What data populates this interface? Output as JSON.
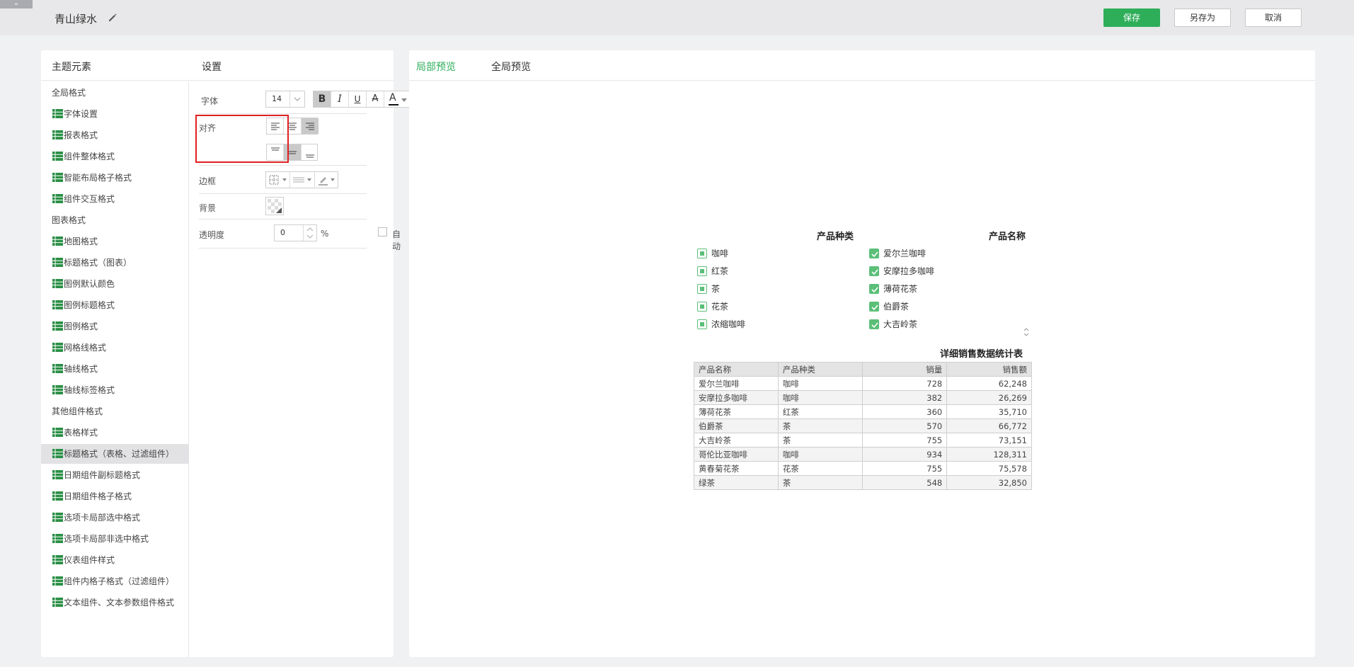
{
  "header": {
    "collapse_glyph": "⌄",
    "title": "青山绿水",
    "save_label": "保存",
    "save_as_label": "另存为",
    "cancel_label": "取消",
    "accent_color": "#2fae5a"
  },
  "left_panel": {
    "elements_heading": "主题元素",
    "settings_heading": "设置",
    "items": [
      {
        "label": "全局格式",
        "type": "group"
      },
      {
        "label": "字体设置",
        "type": "child"
      },
      {
        "label": "报表格式",
        "type": "child"
      },
      {
        "label": "组件整体格式",
        "type": "child"
      },
      {
        "label": "智能布局格子格式",
        "type": "child"
      },
      {
        "label": "组件交互格式",
        "type": "child"
      },
      {
        "label": "图表格式",
        "type": "group"
      },
      {
        "label": "地图格式",
        "type": "child"
      },
      {
        "label": "标题格式（图表）",
        "type": "child"
      },
      {
        "label": "图例默认颜色",
        "type": "child"
      },
      {
        "label": "图例标题格式",
        "type": "child"
      },
      {
        "label": "图例格式",
        "type": "child"
      },
      {
        "label": "网格线格式",
        "type": "child"
      },
      {
        "label": "轴线格式",
        "type": "child"
      },
      {
        "label": "轴线标签格式",
        "type": "child"
      },
      {
        "label": "其他组件格式",
        "type": "group"
      },
      {
        "label": "表格样式",
        "type": "child"
      },
      {
        "label": "标题格式（表格、过滤组件）",
        "type": "child",
        "selected": true
      },
      {
        "label": "日期组件副标题格式",
        "type": "child"
      },
      {
        "label": "日期组件格子格式",
        "type": "child"
      },
      {
        "label": "选项卡局部选中格式",
        "type": "child"
      },
      {
        "label": "选项卡局部非选中格式",
        "type": "child"
      },
      {
        "label": "仪表组件样式",
        "type": "child"
      },
      {
        "label": "组件内格子格式（过滤组件）",
        "type": "child"
      },
      {
        "label": "文本组件、文本参数组件格式",
        "type": "child"
      }
    ]
  },
  "settings": {
    "font_label": "字体",
    "font_size": "14",
    "bold": "B",
    "italic": "I",
    "underline": "U",
    "strike": "A",
    "font_color_glyph": "A",
    "align_label": "对齐",
    "border_label": "边框",
    "background_label": "背景",
    "opacity_label": "透明度",
    "opacity_value": "0",
    "opacity_unit": "%",
    "auto_label": "自动",
    "horizontal_align_selected": "right",
    "vertical_align_selected": "middle"
  },
  "preview": {
    "tab_local": "局部预览",
    "tab_global": "全局预览",
    "filter1_title": "产品种类",
    "filter2_title": "产品名称",
    "filter1_items": [
      "咖啡",
      "红茶",
      "茶",
      "花茶",
      "浓缩咖啡"
    ],
    "filter2_items": [
      "爱尔兰咖啡",
      "安摩拉多咖啡",
      "薄荷花茶",
      "伯爵茶",
      "大吉岭茶"
    ],
    "table_title": "详细销售数据统计表",
    "table_headers": [
      "产品名称",
      "产品种类",
      "销量",
      "销售额"
    ],
    "table_rows": [
      [
        "爱尔兰咖啡",
        "咖啡",
        "728",
        "62,248"
      ],
      [
        "安摩拉多咖啡",
        "咖啡",
        "382",
        "26,269"
      ],
      [
        "薄荷花茶",
        "红茶",
        "360",
        "35,710"
      ],
      [
        "伯爵茶",
        "茶",
        "570",
        "66,772"
      ],
      [
        "大吉岭茶",
        "茶",
        "755",
        "73,151"
      ],
      [
        "哥伦比亚咖啡",
        "咖啡",
        "934",
        "128,311"
      ],
      [
        "黄春菊花茶",
        "花茶",
        "755",
        "75,578"
      ],
      [
        "绿茶",
        "茶",
        "548",
        "32,850"
      ]
    ]
  }
}
